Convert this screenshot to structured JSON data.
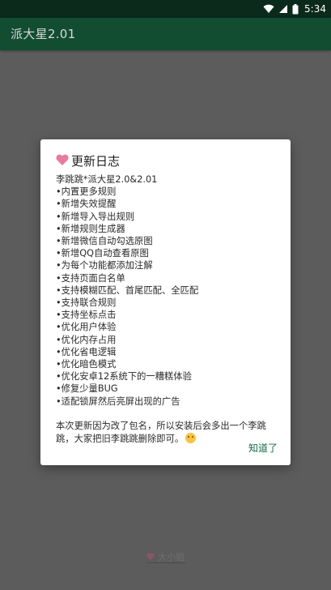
{
  "status_bar": {
    "time": "5:34"
  },
  "app_bar": {
    "title": "派大星2.01"
  },
  "dialog": {
    "title": "更新日志",
    "lines": [
      "李跳跳*派大星2.0&2.01",
      "•内置更多规则",
      "•新增失效提醒",
      "•新增导入导出规则",
      "•新增规则生成器",
      "•新增微信自动勾选原图",
      "•新增QQ自动查看原图",
      "•为每个功能都添加注解",
      "•支持页面白名单",
      "•支持模糊匹配、首尾匹配、全匹配",
      "•支持联合规则",
      "•支持坐标点击",
      "•优化用户体验",
      "•优化内存占用",
      "•优化省电逻辑",
      "•优化暗色模式",
      "•优化安卓12系统下的一糟糕体验",
      "•修复少量BUG",
      "•适配锁屏然后亮屏出现的广告"
    ],
    "note": "本次更新因为改了包名，所以安装后会多出一个李跳跳，大家把旧李跳跳删除即可。",
    "ok_label": "知道了"
  },
  "footer": {
    "label": "大小姐"
  },
  "colors": {
    "status_bar": "#0b2a1b",
    "app_bar": "#124d31",
    "scrim": "#5c5c5c",
    "accent": "#1a6b4a",
    "heart": "#e87aa0"
  }
}
